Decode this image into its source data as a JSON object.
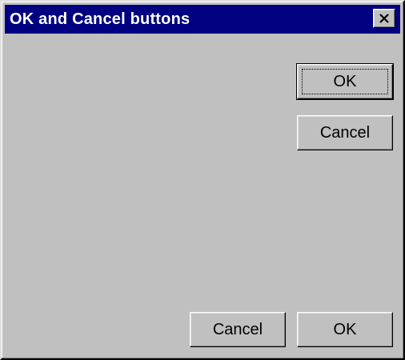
{
  "window": {
    "title": "OK and Cancel buttons"
  },
  "titlebar": {
    "close_icon": "close-icon",
    "colors": {
      "background": "#000080",
      "text": "#ffffff"
    }
  },
  "buttons": {
    "right_column": {
      "ok_label": "OK",
      "cancel_label": "Cancel"
    },
    "bottom_row": {
      "cancel_label": "Cancel",
      "ok_label": "OK"
    }
  },
  "colors": {
    "face": "#c0c0c0",
    "highlight": "#ffffff",
    "shadow": "#808080",
    "dark_shadow": "#000000"
  }
}
